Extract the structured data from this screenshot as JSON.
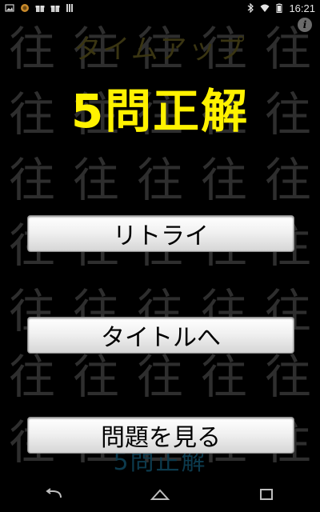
{
  "status_bar": {
    "time": "16:21",
    "left_icons": [
      "gallery-icon",
      "coin-icon",
      "gift-icon",
      "gift-icon",
      "signal-icon"
    ],
    "right_icons": [
      "bluetooth-icon",
      "wifi-icon",
      "battery-icon"
    ]
  },
  "game": {
    "background_glyph": "往",
    "overlay_top": "タイムアップ",
    "result_headline": "5問正解",
    "overlay_bottom": "5問正解",
    "colors": {
      "headline": "#fff200",
      "background_glyph": "#2e2e2e",
      "overlay_top": "#3a3512",
      "overlay_bottom": "#0c3a4d"
    }
  },
  "buttons": {
    "retry": "リトライ",
    "to_title": "タイトルへ",
    "view_questions": "問題を見る"
  },
  "info_icon": "i",
  "nav_bar": {
    "icons": [
      "back-icon",
      "home-icon",
      "recent-apps-icon"
    ]
  }
}
